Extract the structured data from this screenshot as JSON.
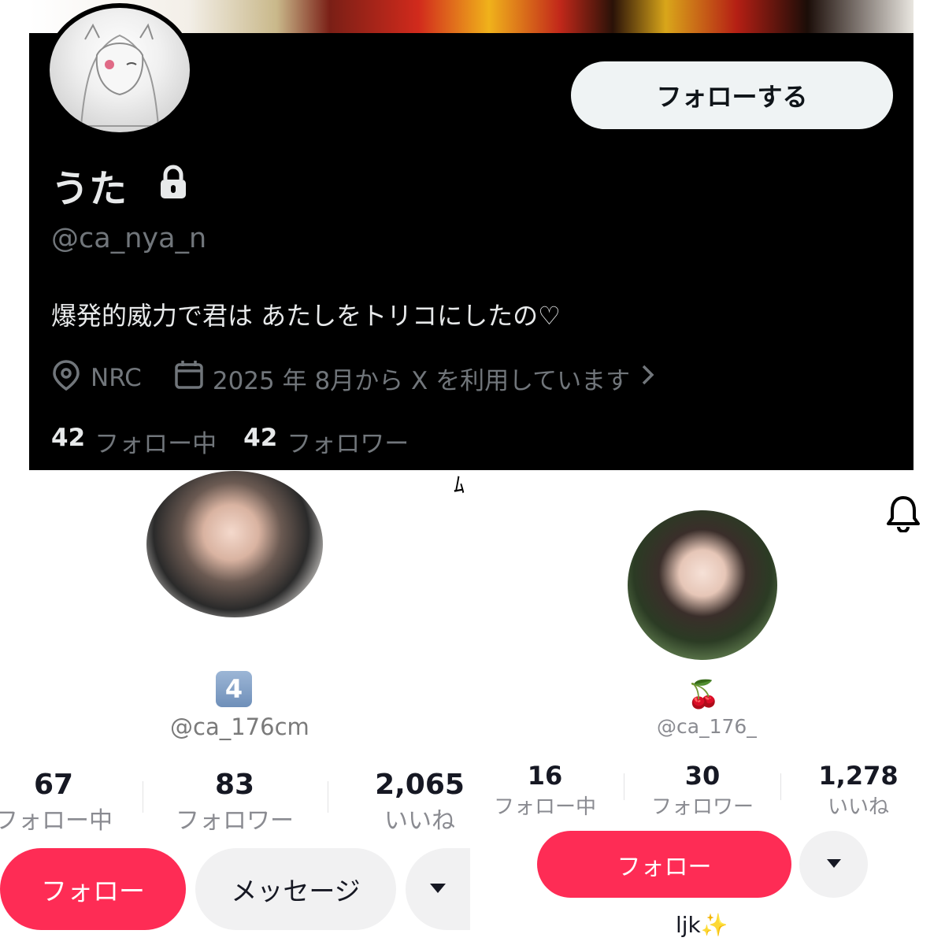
{
  "x_profile": {
    "follow_button": "フォローする",
    "name": "うた",
    "handle": "@ca_nya_n",
    "bio": "爆発的威力で君は あたしをトリコにしたの♡",
    "location": "NRC",
    "joined": "2025 年 8月から X を利用しています",
    "following_count": "42",
    "following_label": "フォロー中",
    "followers_count": "42",
    "followers_label": "フォロワー",
    "icons": [
      "lock-icon",
      "location-pin-icon",
      "calendar-icon",
      "chevron-right-icon"
    ]
  },
  "tiktok_left": {
    "badge": "4",
    "handle": "@ca_176cm",
    "stats": [
      {
        "num": "67",
        "label": "フォロー中"
      },
      {
        "num": "83",
        "label": "フォロワー"
      },
      {
        "num": "2,065",
        "label": "いいね"
      }
    ],
    "follow_button": "フォロー",
    "message_button": "メッセージ"
  },
  "tiktok_right": {
    "emoji": "🍒",
    "handle": "@ca_176_",
    "stats": [
      {
        "num": "16",
        "label": "フォロー中"
      },
      {
        "num": "30",
        "label": "フォロワー"
      },
      {
        "num": "1,278",
        "label": "いいね"
      }
    ],
    "follow_button": "フォロー",
    "bio": "ljk✨"
  },
  "colors": {
    "tiktok_red": "#fe2c55",
    "x_black": "#000000",
    "x_muted": "#71767b"
  }
}
